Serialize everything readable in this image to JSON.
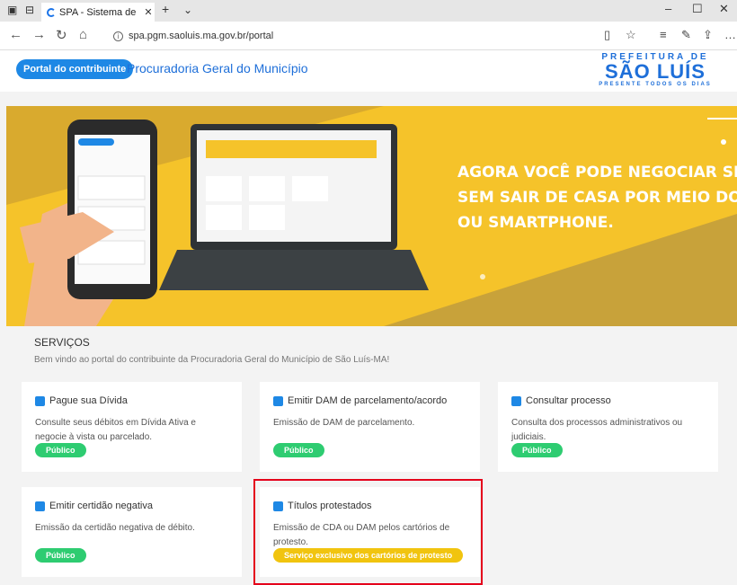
{
  "browser": {
    "tab_title": "SPA - Sistema de Proce:",
    "url": "spa.pgm.saoluis.ma.gov.br/portal"
  },
  "header": {
    "portal_label": "Portal do contribuinte",
    "title": "Procuradoria Geral do Município",
    "logo_line1": "PREFEITURA DE",
    "logo_line2": "SÃO LUÍS",
    "logo_line3": "PRESENTE TODOS OS DIAS"
  },
  "hero": {
    "line1": "AGORA VOCÊ PODE NEGOCIAR SEUS DÉBITO",
    "line2": "SEM SAIR DE CASA POR MEIO DO SEU COMPUTADO",
    "line3": "OU SMARTPHONE."
  },
  "services": {
    "title": "SERVIÇOS",
    "subtitle": "Bem vindo ao portal do contribuinte da Procuradoria Geral do Município de São Luís-MA!",
    "cards": [
      {
        "icon": "money-icon",
        "title": "Pague sua Dívida",
        "description": "Consulte seus débitos em Dívida Ativa e negocie à vista ou parcelado.",
        "badge": "Público"
      },
      {
        "icon": "print-icon",
        "title": "Emitir DAM de parcelamento/acordo",
        "description": "Emissão de DAM de parcelamento.",
        "badge": "Público"
      },
      {
        "icon": "document-icon",
        "title": "Consultar processo",
        "description": "Consulta dos processos administrativos ou judiciais.",
        "badge": "Público"
      },
      {
        "icon": "check-icon",
        "title": "Emitir certidão negativa",
        "description": "Emissão da certidão negativa de débito.",
        "badge": "Público"
      },
      {
        "icon": "document-icon",
        "title": "Títulos protestados",
        "description": "Emissão de CDA ou DAM pelos cartórios de protesto.",
        "badge": "Serviço exclusivo dos cartórios de protesto"
      }
    ]
  },
  "colors": {
    "primary": "#1e88e5",
    "hero": "#c8a23a",
    "public_badge": "#2ecc71",
    "exclusive_badge": "#f1c40f",
    "highlight": "#e4001b"
  }
}
